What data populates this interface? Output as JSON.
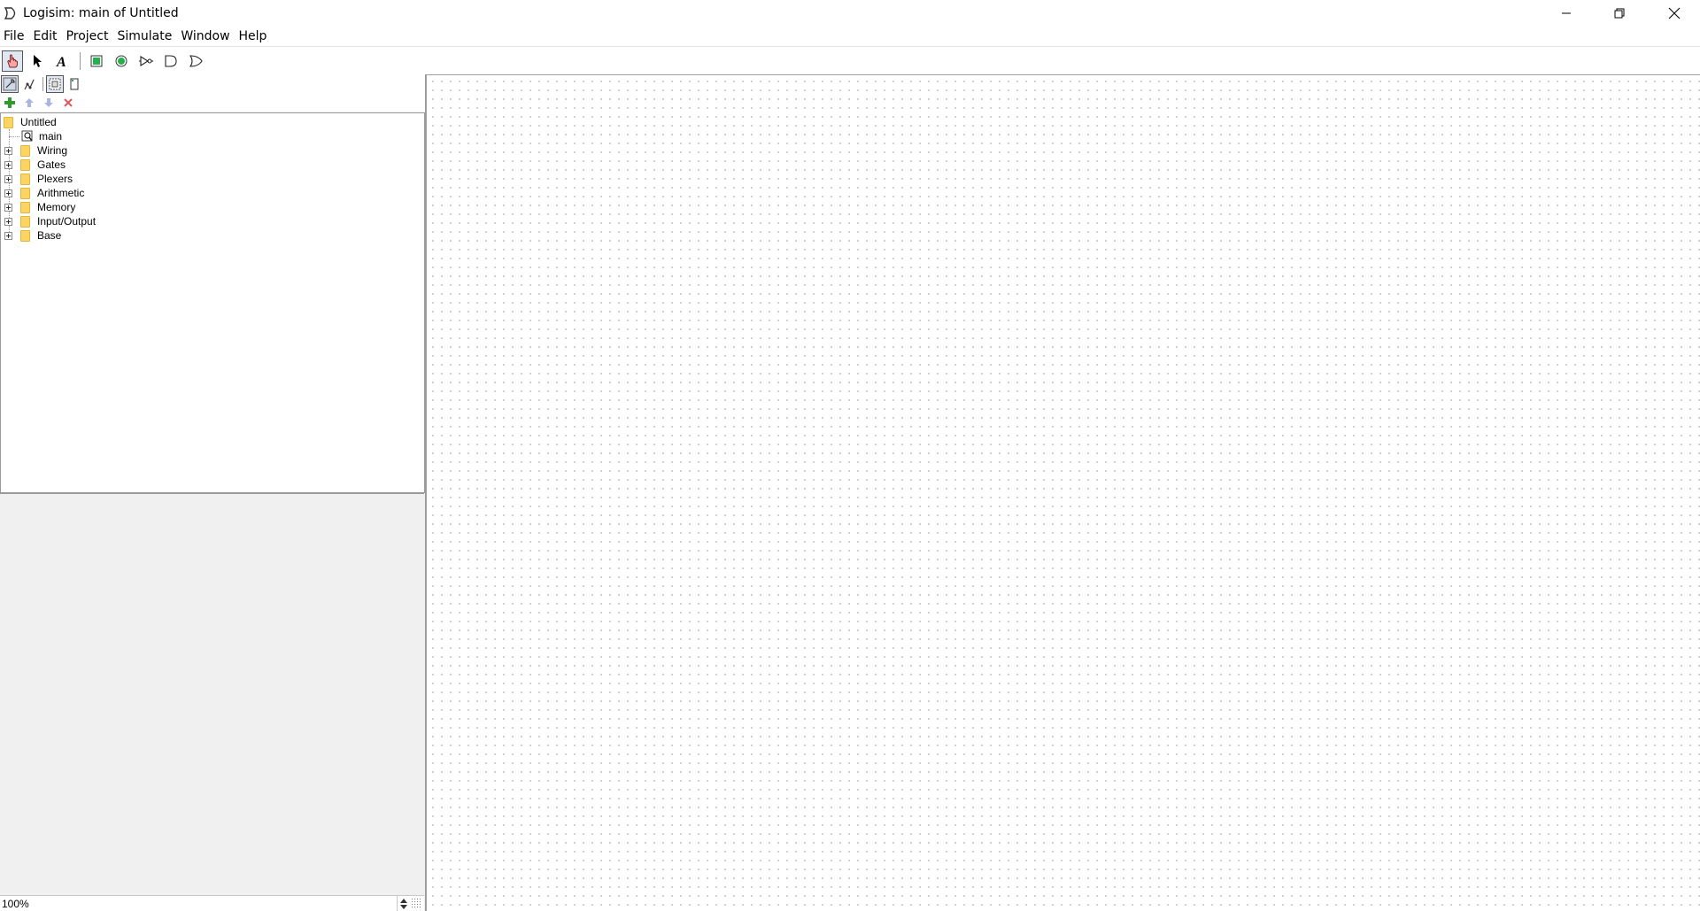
{
  "window": {
    "title": "Logisim: main of Untitled"
  },
  "menu": {
    "items": [
      "File",
      "Edit",
      "Project",
      "Simulate",
      "Window",
      "Help"
    ]
  },
  "toolbar": {
    "tools": [
      "poke-tool",
      "select-tool",
      "text-tool",
      "input-pin",
      "output-pin",
      "not-gate",
      "and-gate",
      "or-gate"
    ]
  },
  "explorer": {
    "tree": {
      "root": "Untitled",
      "circuit": "main",
      "libraries": [
        "Wiring",
        "Gates",
        "Plexers",
        "Arithmetic",
        "Memory",
        "Input/Output",
        "Base"
      ]
    }
  },
  "zoom": {
    "value": "100%"
  },
  "colors": {
    "folder": "#fcd462",
    "add_green": "#2e9b2e",
    "delete_red": "#e05a5a",
    "canvas_dot": "#a8a8a8"
  }
}
